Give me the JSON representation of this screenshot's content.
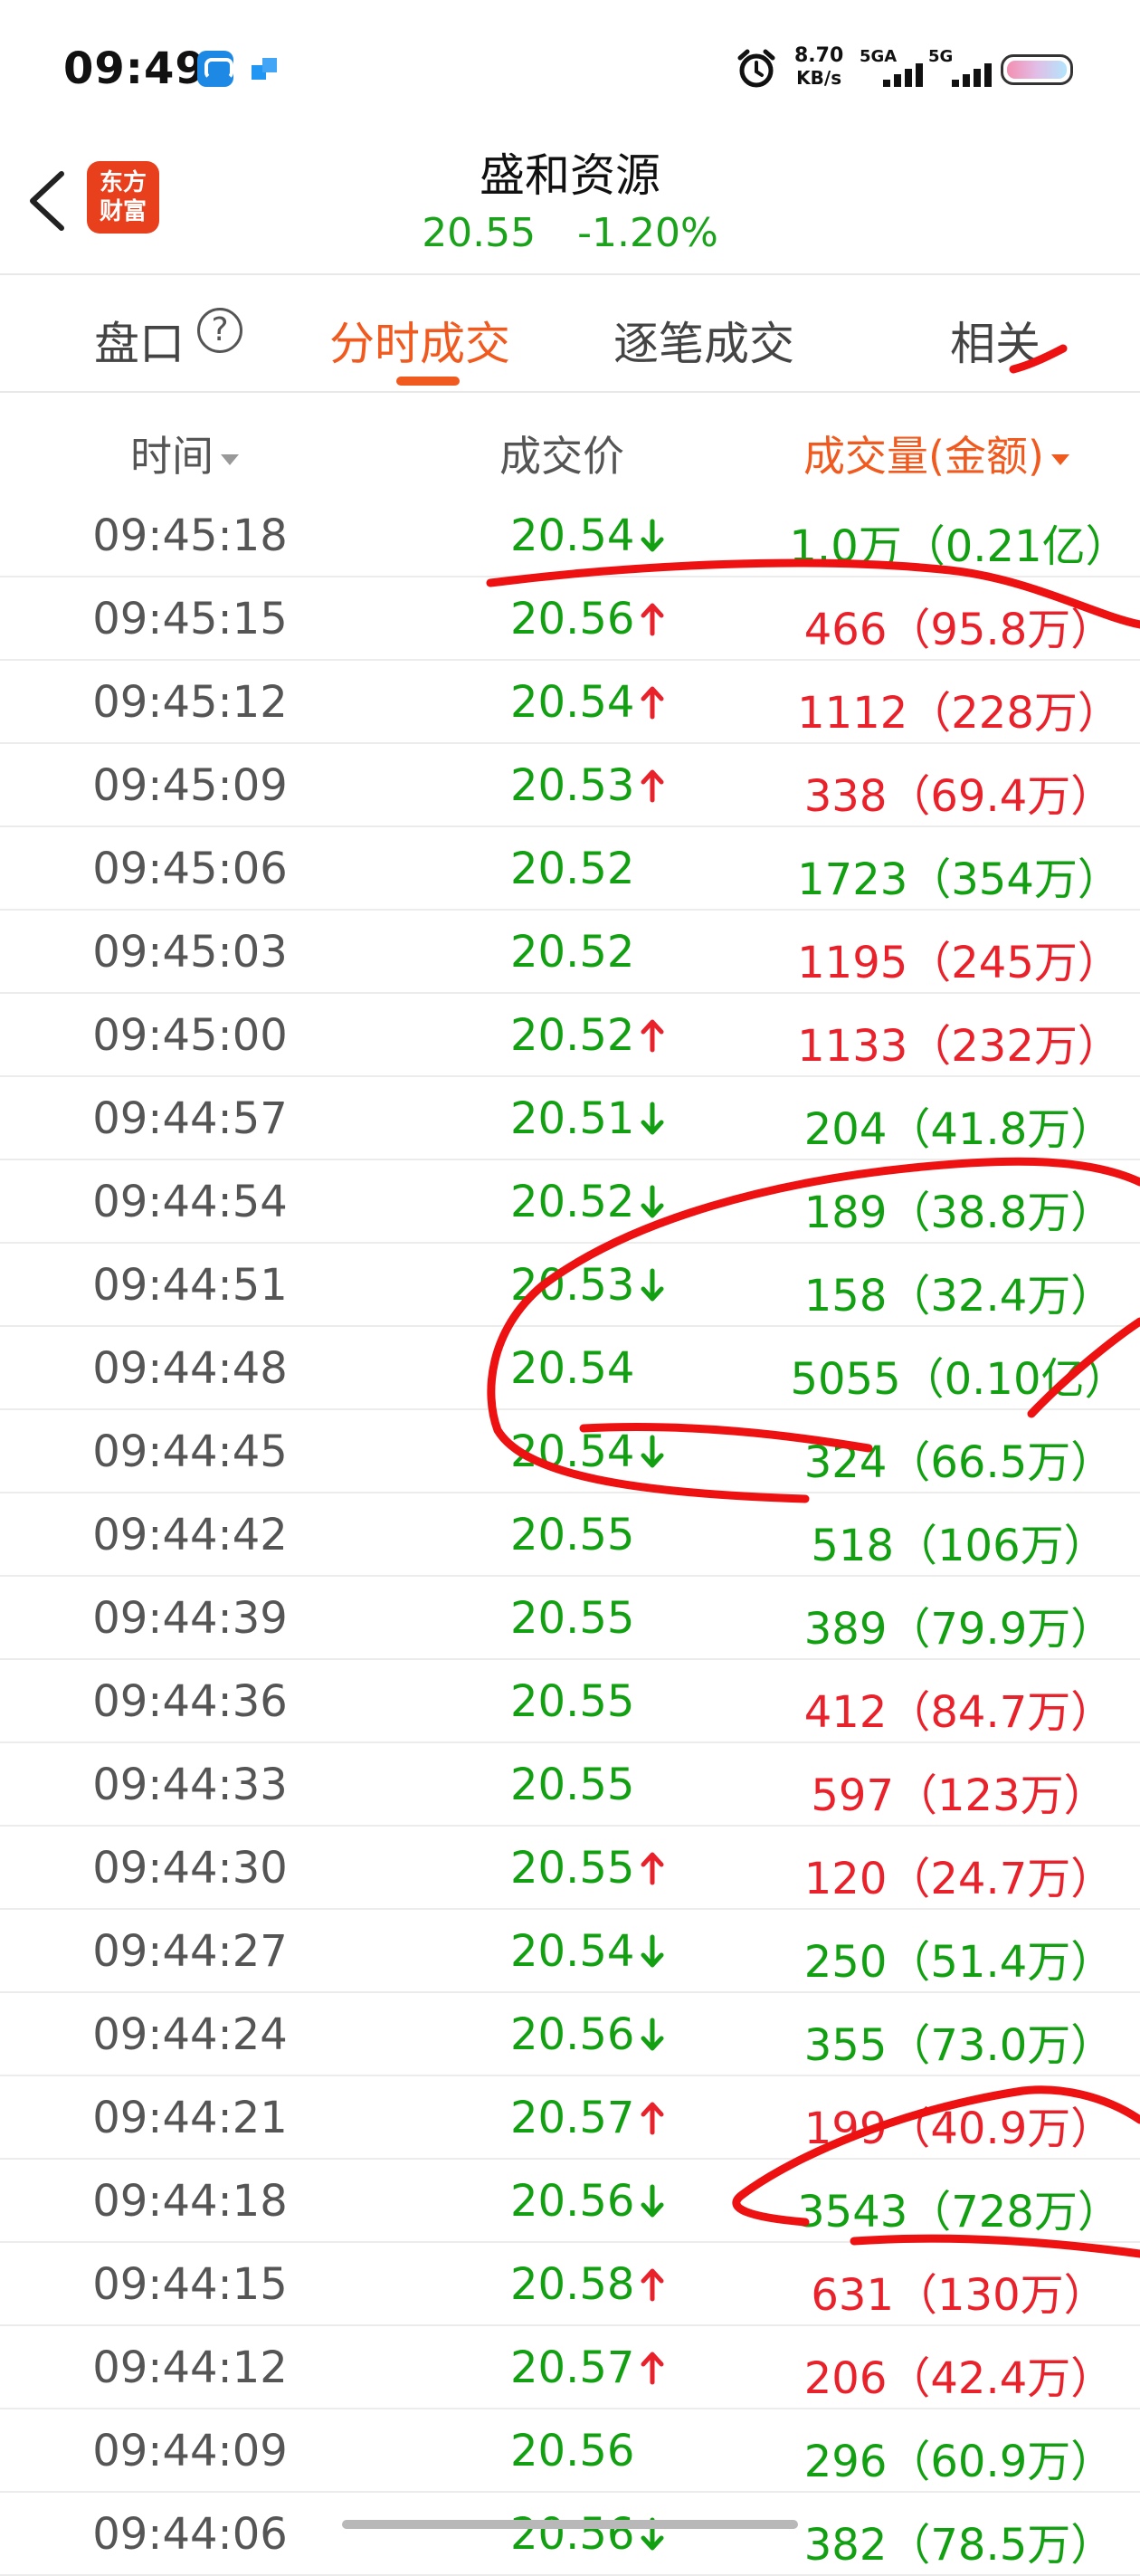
{
  "status_bar": {
    "time": "09:49",
    "net_speed_value": "8.70",
    "net_speed_unit": "KB/s",
    "sim1_label": "5GA",
    "sim2_label": "5G"
  },
  "header": {
    "logo_line1": "东方",
    "logo_line2": "财富",
    "stock_name": "盛和资源",
    "price": "20.55",
    "change_pct": "-1.20%"
  },
  "tabs": [
    {
      "label": "盘口",
      "active": false
    },
    {
      "label": "分时成交",
      "active": true
    },
    {
      "label": "逐笔成交",
      "active": false
    },
    {
      "label": "相关",
      "active": false
    }
  ],
  "columns": {
    "time": "时间",
    "price": "成交价",
    "volume": "成交量(金额)"
  },
  "colors": {
    "up": "#e8212a",
    "down": "#12a012",
    "accent": "#f05a1e"
  },
  "trades": [
    {
      "time": "09:45:18",
      "price": "20.54",
      "dir": "down",
      "vol": "1.0万（0.21亿）",
      "vc": "green"
    },
    {
      "time": "09:45:15",
      "price": "20.56",
      "dir": "up",
      "vol": "466（95.8万）",
      "vc": "red"
    },
    {
      "time": "09:45:12",
      "price": "20.54",
      "dir": "up",
      "vol": "1112（228万）",
      "vc": "red"
    },
    {
      "time": "09:45:09",
      "price": "20.53",
      "dir": "up",
      "vol": "338（69.4万）",
      "vc": "red"
    },
    {
      "time": "09:45:06",
      "price": "20.52",
      "dir": "",
      "vol": "1723（354万）",
      "vc": "green"
    },
    {
      "time": "09:45:03",
      "price": "20.52",
      "dir": "",
      "vol": "1195（245万）",
      "vc": "red"
    },
    {
      "time": "09:45:00",
      "price": "20.52",
      "dir": "up",
      "vol": "1133（232万）",
      "vc": "red"
    },
    {
      "time": "09:44:57",
      "price": "20.51",
      "dir": "down",
      "vol": "204（41.8万）",
      "vc": "green"
    },
    {
      "time": "09:44:54",
      "price": "20.52",
      "dir": "down",
      "vol": "189（38.8万）",
      "vc": "green"
    },
    {
      "time": "09:44:51",
      "price": "20.53",
      "dir": "down",
      "vol": "158（32.4万）",
      "vc": "green"
    },
    {
      "time": "09:44:48",
      "price": "20.54",
      "dir": "",
      "vol": "5055（0.10亿）",
      "vc": "green"
    },
    {
      "time": "09:44:45",
      "price": "20.54",
      "dir": "down",
      "vol": "324（66.5万）",
      "vc": "green"
    },
    {
      "time": "09:44:42",
      "price": "20.55",
      "dir": "",
      "vol": "518（106万）",
      "vc": "green"
    },
    {
      "time": "09:44:39",
      "price": "20.55",
      "dir": "",
      "vol": "389（79.9万）",
      "vc": "green"
    },
    {
      "time": "09:44:36",
      "price": "20.55",
      "dir": "",
      "vol": "412（84.7万）",
      "vc": "red"
    },
    {
      "time": "09:44:33",
      "price": "20.55",
      "dir": "",
      "vol": "597（123万）",
      "vc": "red"
    },
    {
      "time": "09:44:30",
      "price": "20.55",
      "dir": "up",
      "vol": "120（24.7万）",
      "vc": "red"
    },
    {
      "time": "09:44:27",
      "price": "20.54",
      "dir": "down",
      "vol": "250（51.4万）",
      "vc": "green"
    },
    {
      "time": "09:44:24",
      "price": "20.56",
      "dir": "down",
      "vol": "355（73.0万）",
      "vc": "green"
    },
    {
      "time": "09:44:21",
      "price": "20.57",
      "dir": "up",
      "vol": "199（40.9万）",
      "vc": "red"
    },
    {
      "time": "09:44:18",
      "price": "20.56",
      "dir": "down",
      "vol": "3543（728万）",
      "vc": "green"
    },
    {
      "time": "09:44:15",
      "price": "20.58",
      "dir": "up",
      "vol": "631（130万）",
      "vc": "red"
    },
    {
      "time": "09:44:12",
      "price": "20.57",
      "dir": "up",
      "vol": "206（42.4万）",
      "vc": "red"
    },
    {
      "time": "09:44:09",
      "price": "20.56",
      "dir": "",
      "vol": "296（60.9万）",
      "vc": "green"
    },
    {
      "time": "09:44:06",
      "price": "20.56",
      "dir": "down",
      "vol": "382（78.5万）",
      "vc": "green"
    }
  ]
}
